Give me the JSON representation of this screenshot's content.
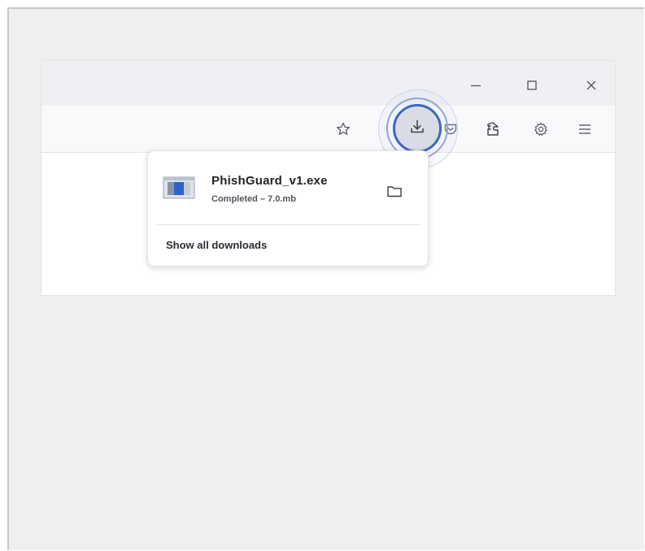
{
  "titlebar": {
    "minimize_icon": "minimize-icon",
    "maximize_icon": "maximize-icon",
    "close_icon": "close-icon"
  },
  "toolbar": {
    "bookmark_icon": "star-icon",
    "downloads_icon": "download-icon",
    "pocket_icon": "pocket-icon",
    "extensions_icon": "puzzle-icon",
    "settings_icon": "gear-icon",
    "menu_icon": "hamburger-menu-icon",
    "downloads_highlight_color": "#3f66c0"
  },
  "downloads_panel": {
    "items": [
      {
        "file_name": "PhishGuard_v1.exe",
        "status": "Completed – 7.0.mb",
        "icon": "executable-file-icon",
        "action_icon": "folder-icon"
      }
    ],
    "show_all_label": "Show all downloads"
  }
}
